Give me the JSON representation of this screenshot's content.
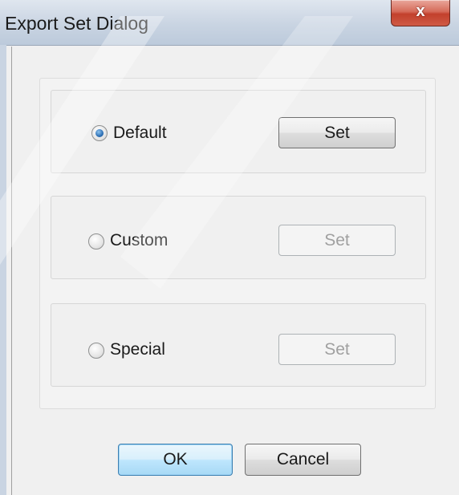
{
  "window": {
    "title": "Export Set Dialog",
    "close_glyph": "x"
  },
  "options": [
    {
      "label": "Default",
      "selected": true,
      "set_label": "Set",
      "set_enabled": true
    },
    {
      "label": "Custom",
      "selected": false,
      "set_label": "Set",
      "set_enabled": false
    },
    {
      "label": "Special",
      "selected": false,
      "set_label": "Set",
      "set_enabled": false
    }
  ],
  "footer": {
    "ok_label": "OK",
    "cancel_label": "Cancel"
  },
  "colors": {
    "close_button": "#c2402c",
    "radio_selected": "#2d6fb4",
    "default_button_border": "#3c7fb1",
    "titlebar": "#c9d4e2"
  }
}
